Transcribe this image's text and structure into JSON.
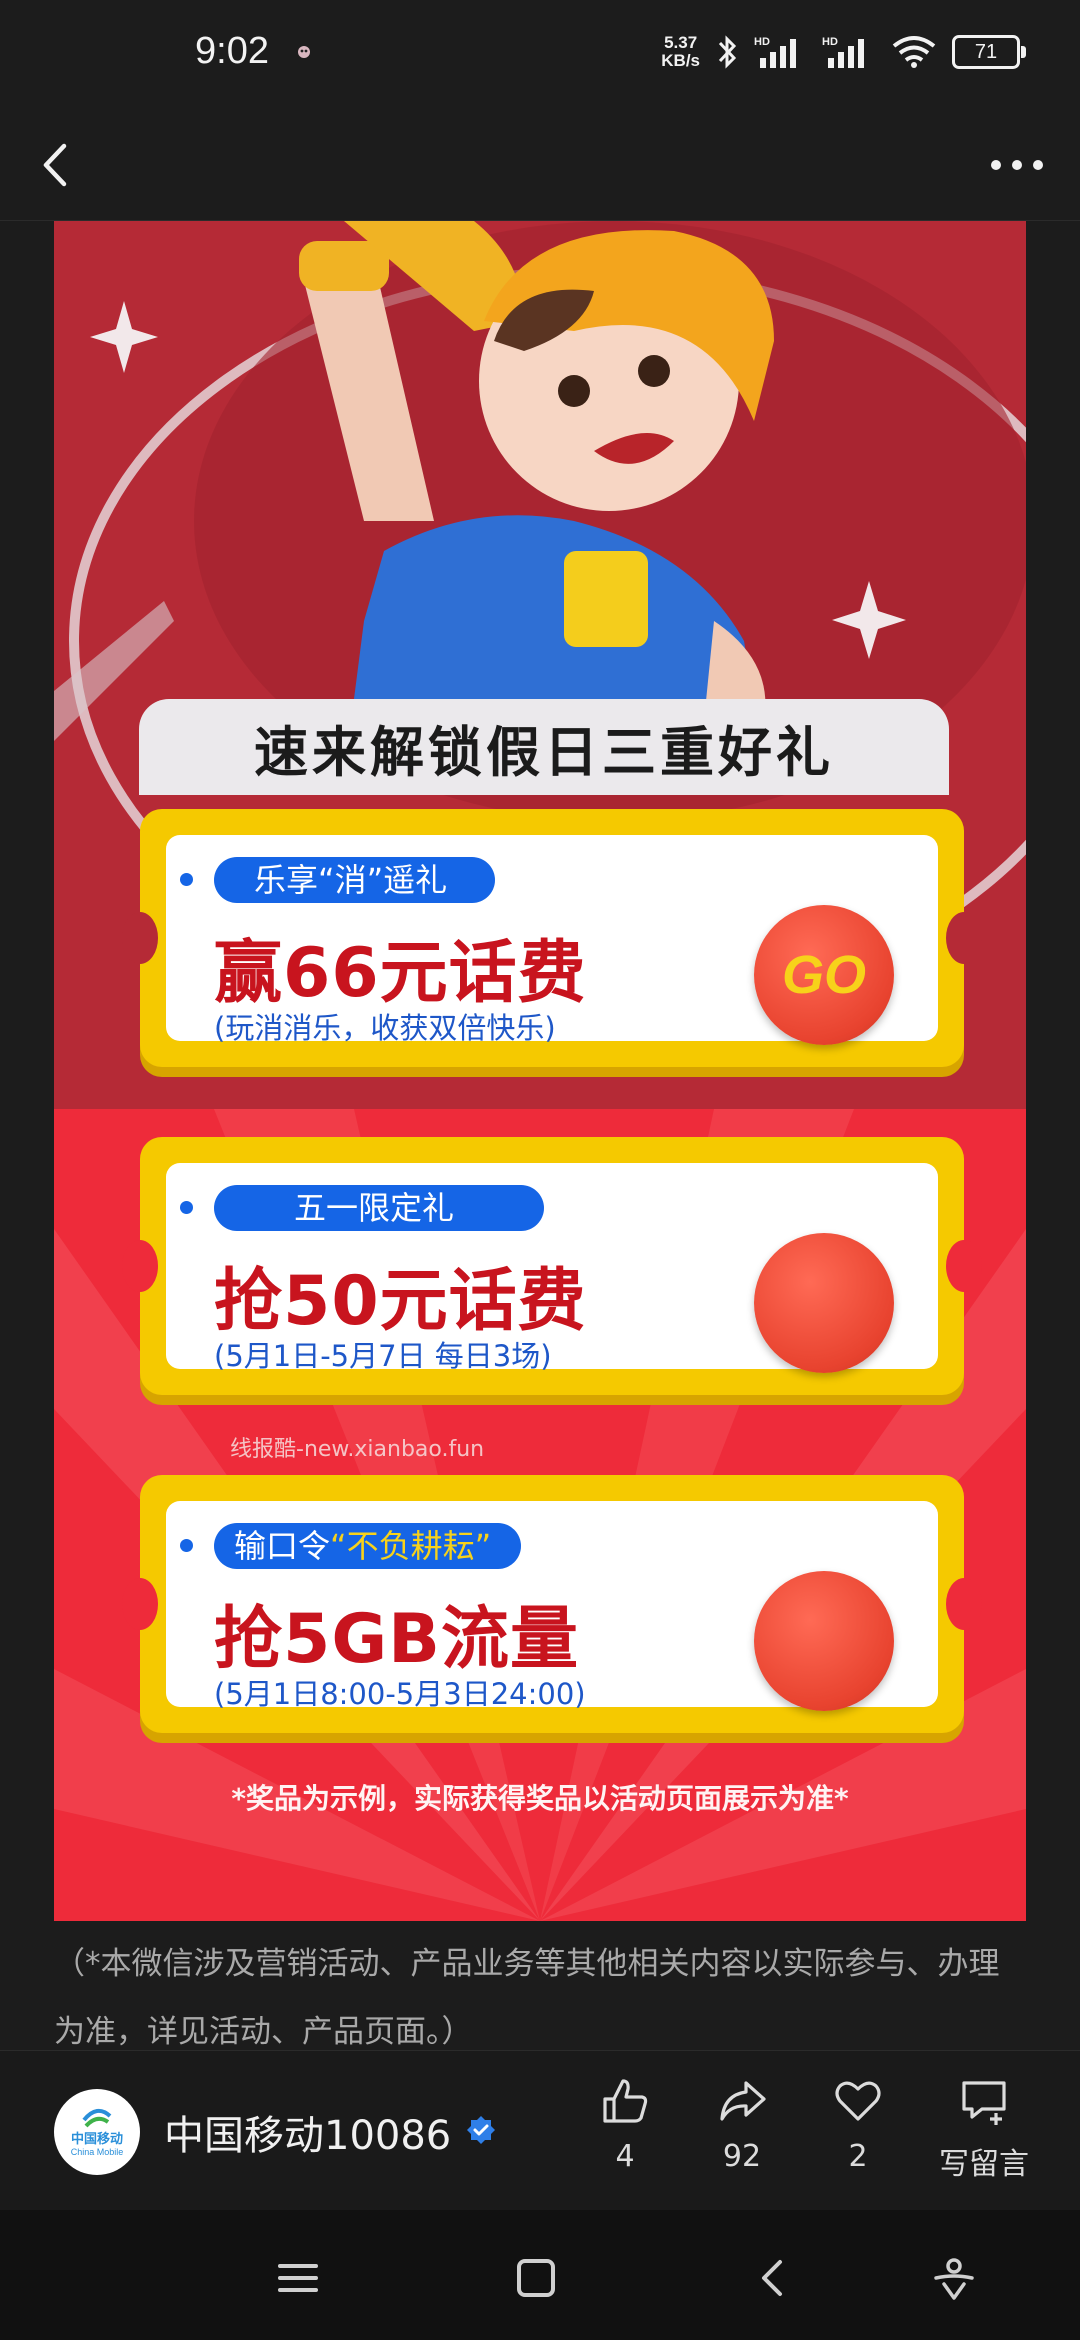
{
  "status": {
    "time": "9:02",
    "net_speed_value": "5.37",
    "net_speed_unit": "KB/s",
    "battery": "71"
  },
  "poster": {
    "headline": "速来解锁假日三重好礼",
    "tickets": [
      {
        "tag": "乐享“消”遥礼",
        "title": "赢66元话费",
        "subtitle": "(玩消消乐，收获双倍快乐)",
        "button": "GO"
      },
      {
        "tag": "五一限定礼",
        "title": "抢50元话费",
        "subtitle": "(5月1日-5月7日 每日3场)",
        "button": ""
      },
      {
        "tag_prefix": "输口令",
        "tag_highlight": "“不负耕耘”",
        "title": "抢5GB流量",
        "subtitle": "(5月1日8:00-5月3日24:00)",
        "button": ""
      }
    ],
    "watermark": "线报酷-new.xianbao.fun",
    "disclaimer": "*奖品为示例，实际获得奖品以活动页面展示为准*"
  },
  "caption": "（*本微信涉及营销活动、产品业务等其他相关内容以实际参与、办理为准，详见活动、产品页面。）",
  "author": {
    "avatar_cn": "中国移动",
    "avatar_en": "China Mobile",
    "name": "中国移动10086",
    "likes": "4",
    "shares": "92",
    "favorites": "2",
    "comment_label": "写留言"
  },
  "colors": {
    "poster_top": "#b52a36",
    "poster_bottom": "#ee2b3a",
    "ticket_border": "#f5c900",
    "tag_blue": "#1565e6",
    "title_red": "#c8141e",
    "verified_blue": "#2f7fe8"
  },
  "icons": [
    "back-arrow-icon",
    "more-dots-icon",
    "bluetooth-icon",
    "signal-icon",
    "wifi-icon",
    "thumbs-up-icon",
    "share-icon",
    "heart-icon",
    "comment-icon",
    "menu-icon",
    "home-icon",
    "back-icon",
    "accessibility-icon",
    "verified-icon"
  ]
}
